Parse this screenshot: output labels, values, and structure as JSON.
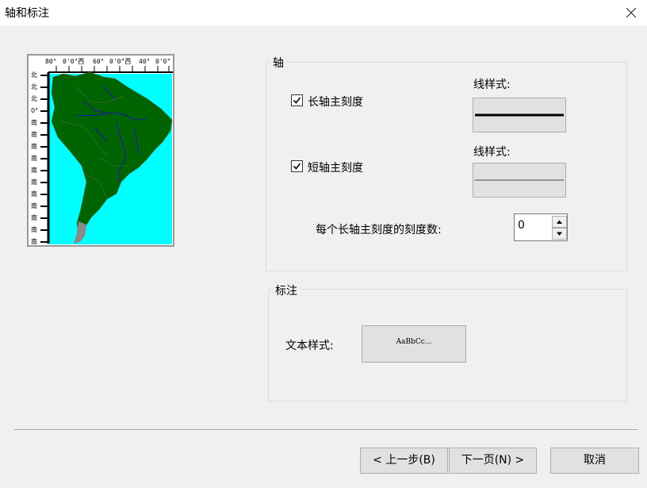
{
  "window": {
    "title": "轴和标注"
  },
  "preview": {
    "top_ticks": [
      "80°",
      "0'0\"西",
      "60°",
      "0'0\"西",
      "40°",
      "0'0\""
    ],
    "left_ticks": [
      "北",
      "北",
      "北",
      "0°",
      "南",
      "南",
      "南",
      "南",
      "南",
      "南",
      "南",
      "南",
      "南",
      "南",
      "南"
    ]
  },
  "axis_group": {
    "label": "轴",
    "major": {
      "label": "长轴主刻度",
      "checked": true,
      "style_label": "线样式:"
    },
    "minor": {
      "label": "短轴主刻度",
      "checked": true,
      "style_label": "线样式:"
    },
    "ticks_per_major": {
      "label": "每个长轴主刻度的刻度数:",
      "value": "0"
    }
  },
  "annotation_group": {
    "label": "标注",
    "text_style_label": "文本样式:",
    "text_style_sample": "AaBbCc..."
  },
  "footer": {
    "back_label": "< 上一步(B)",
    "next_label": "下一页(N) >",
    "cancel_label": "取消"
  },
  "colors": {
    "ocean": "#00ffff",
    "land": "#006400",
    "river": "#1a1aa0"
  }
}
